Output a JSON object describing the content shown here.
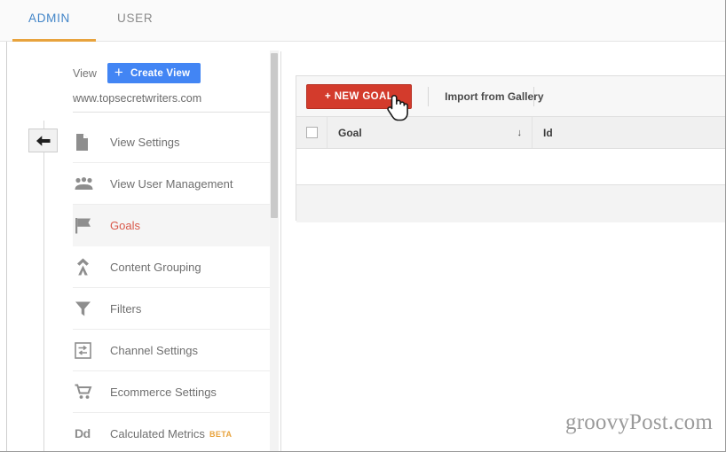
{
  "tabs": [
    {
      "label": "ADMIN",
      "active": true
    },
    {
      "label": "USER",
      "active": false
    }
  ],
  "colors": {
    "tab_active": "#4285c8",
    "tab_underline": "#e8a33d",
    "create_view_blue": "#4285f4",
    "new_goal_red": "#d33b2c",
    "selected_item_red": "#d9584a",
    "beta_orange": "#e8a33d"
  },
  "sidebar": {
    "view_label": "View",
    "create_view_button": "Create View",
    "create_view_plus": "+",
    "view_url": "www.topsecretwriters.com",
    "collapse_icon": "back-arrow-icon",
    "items": [
      {
        "label": "View Settings",
        "icon": "document-icon",
        "selected": false,
        "badge": ""
      },
      {
        "label": "View User Management",
        "icon": "people-icon",
        "selected": false,
        "badge": ""
      },
      {
        "label": "Goals",
        "icon": "flag-icon",
        "selected": true,
        "badge": ""
      },
      {
        "label": "Content Grouping",
        "icon": "content-grouping-icon",
        "selected": false,
        "badge": ""
      },
      {
        "label": "Filters",
        "icon": "funnel-icon",
        "selected": false,
        "badge": ""
      },
      {
        "label": "Channel Settings",
        "icon": "channel-settings-icon",
        "selected": false,
        "badge": ""
      },
      {
        "label": "Ecommerce Settings",
        "icon": "shopping-cart-icon",
        "selected": false,
        "badge": ""
      },
      {
        "label": "Calculated Metrics",
        "icon": "dd-icon",
        "selected": false,
        "badge": "BETA"
      }
    ]
  },
  "main": {
    "toolbar": {
      "new_goal_button": "+ NEW GOAL",
      "import_from_gallery": "Import from Gallery"
    },
    "table": {
      "columns": [
        {
          "label": "",
          "name": "checkbox-column"
        },
        {
          "label": "Goal",
          "name": "goal-column",
          "sort": "descending",
          "sort_glyph": "↓"
        },
        {
          "label": "Id",
          "name": "id-column"
        }
      ],
      "rows": []
    }
  },
  "watermark": "groovyPost.com"
}
